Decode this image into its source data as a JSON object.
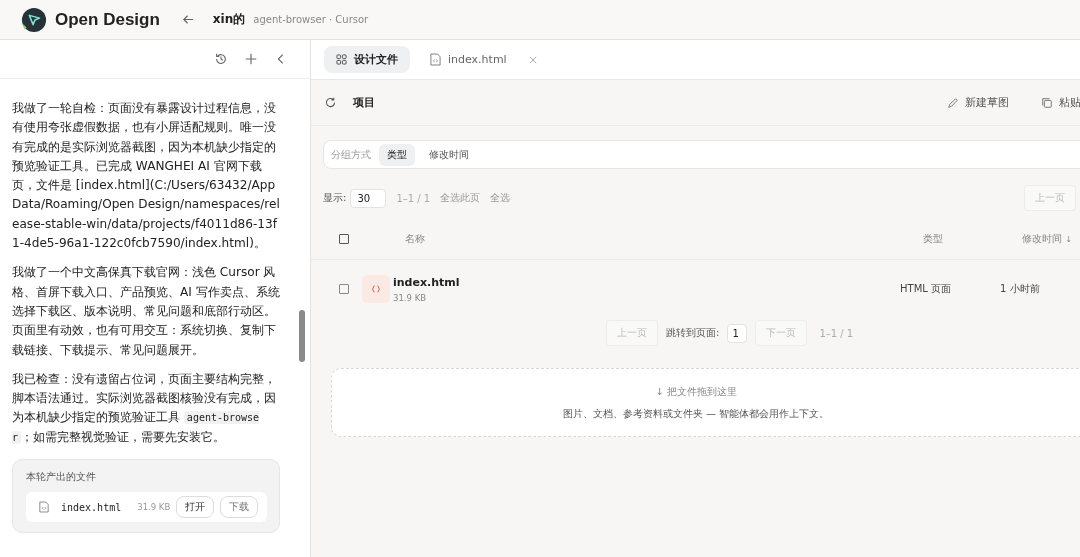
{
  "app": {
    "name": "Open Design",
    "project": "xin的",
    "subtitle": "agent-browser · Cursor"
  },
  "chat": {
    "messages": [
      {
        "segments": [
          {
            "kind": "text",
            "text": "我做了一轮自检：页面没有暴露设计过程信息，没有使用夸张虚假数据，也有小屏适配规则。唯一没有完成的是实际浏览器截图，因为本机缺少指定的预览验证工具。已完成 WANGHEI AI 官网下载页，文件是 [index.html](C:/Users/63432/AppData/Roaming/Open Design/namespaces/release-stable-win/data/projects/f4011d86-13f1-4de5-96a1-122c0fcb7590/index.html)。"
          }
        ]
      },
      {
        "segments": [
          {
            "kind": "text",
            "text": "我做了一个中文高保真下载官网：浅色 Cursor 风格、首屏下载入口、产品预览、AI 写作卖点、系统选择下载区、版本说明、常见问题和底部行动区。页面里有动效，也有可用交互：系统切换、复制下载链接、下载提示、常见问题展开。"
          }
        ]
      },
      {
        "segments": [
          {
            "kind": "text",
            "text": "我已检查：没有遗留占位词，页面主要结构完整，脚本语法通过。实际浏览器截图核验没有完成，因为本机缺少指定的预览验证工具 "
          },
          {
            "kind": "code",
            "text": "agent-browser"
          },
          {
            "kind": "text",
            "text": "；如需完整视觉验证，需要先安装它。"
          }
        ]
      }
    ],
    "output": {
      "title": "本轮产出的文件",
      "file": {
        "name": "index.html",
        "size": "31.9 KB",
        "open": "打开",
        "download": "下载"
      }
    }
  },
  "tabs": [
    {
      "label": "设计文件",
      "selected": true,
      "closable": false
    },
    {
      "label": "index.html",
      "selected": false,
      "closable": true
    }
  ],
  "toolbar": {
    "title": "项目",
    "actions": [
      {
        "label": "新建草图"
      },
      {
        "label": "粘贴"
      }
    ]
  },
  "group_by": {
    "label": "分组方式",
    "options": [
      {
        "label": "类型",
        "selected": true
      },
      {
        "label": "修改时间",
        "selected": false
      }
    ]
  },
  "paging_top": {
    "show_label": "显示:",
    "page_size": "30",
    "range": "1–1 / 1",
    "select_page": "全选此页",
    "select_all": "全选",
    "prev": "上一页"
  },
  "table": {
    "all_checked": false,
    "columns": [
      "名称",
      "类型",
      "修改时间"
    ],
    "sort_mark": "↓",
    "rows": [
      {
        "name": "index.html",
        "size": "31.9 KB",
        "type": "HTML 页面",
        "modified": "1 小时前",
        "checked": false
      }
    ]
  },
  "paging_bottom": {
    "prev": "上一页",
    "jump_label": "跳转到页面:",
    "page": "1",
    "next": "下一页",
    "range": "1–1 / 1"
  },
  "dropzone": {
    "title": "↓ 把文件拖到这里",
    "hint": "图片、文档、参考资料或文件夹 — 智能体都会用作上下文。"
  }
}
